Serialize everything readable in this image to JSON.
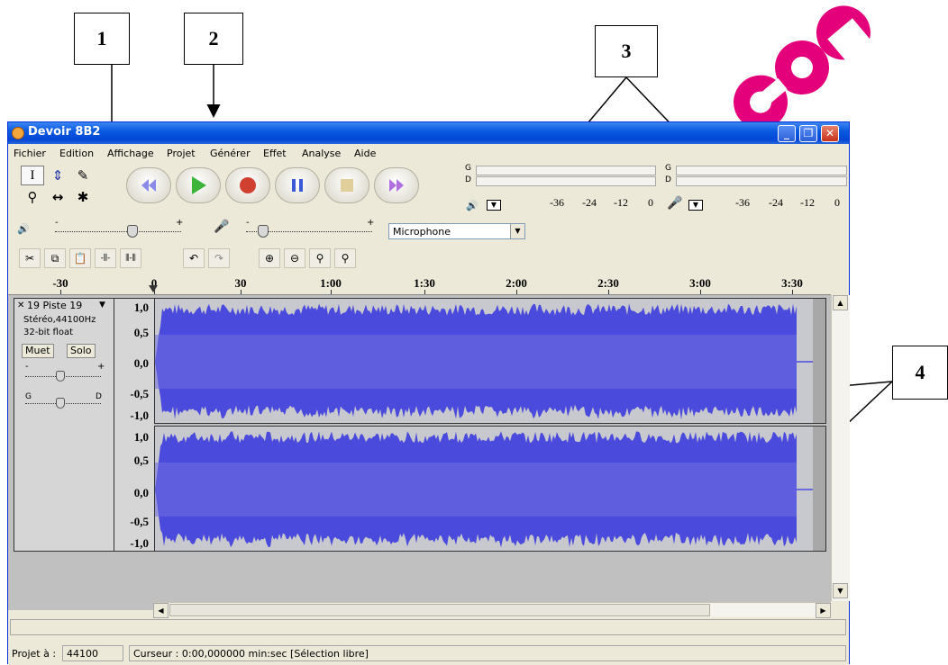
{
  "callouts": [
    "1",
    "2",
    "3",
    "4"
  ],
  "watermark": {
    "text": "com",
    "color": "#e3007a"
  },
  "window": {
    "title": "Devoir 8B2",
    "buttons": {
      "minimize": "_",
      "restore": "❐",
      "close": "✕"
    }
  },
  "menu": [
    "Fichier",
    "Edition",
    "Affichage",
    "Projet",
    "Générer",
    "Effet",
    "Analyse",
    "Aide"
  ],
  "tools": {
    "selection": "I",
    "envelope": "⇕",
    "draw": "✎",
    "zoom": "⚲",
    "timeshift": "↔",
    "multi": "✱"
  },
  "meters": {
    "channel_left": "G",
    "channel_right": "D",
    "ticks": [
      "-36",
      "-24",
      "-12",
      "0"
    ]
  },
  "mixer": {
    "output_minus": "-",
    "output_plus": "+",
    "input_minus": "-",
    "input_plus": "+",
    "output_volume": 0.6,
    "input_volume": 0.1,
    "input_source": "Microphone"
  },
  "ruler": [
    "-30",
    "0",
    "30",
    "1:00",
    "1:30",
    "2:00",
    "2:30",
    "3:00",
    "3:30"
  ],
  "track": {
    "close": "✕",
    "name": "19 Piste 19",
    "dropdown": "▼",
    "format": "Stéréo,44100Hz",
    "bitdepth": "32-bit float",
    "mute": "Muet",
    "solo": "Solo",
    "gain_minus": "-",
    "gain_plus": "+",
    "pan_left": "G",
    "pan_right": "D",
    "scale": [
      "1,0",
      "0,5",
      "0,0",
      "-0,5",
      "-1,0"
    ],
    "waveform_color": "#4a4adc",
    "clip_color": "#7070e0"
  },
  "status": {
    "project_rate_label": "Projet à :",
    "project_rate": "44100",
    "cursor": "Curseur : 0:00,000000 min:sec  [Sélection libre]"
  }
}
